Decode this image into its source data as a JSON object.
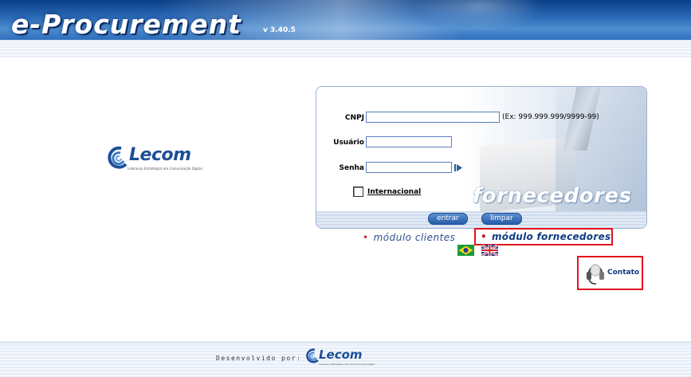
{
  "header": {
    "title": "e-Procurement",
    "version": "v 3.40.5"
  },
  "brand": {
    "logo_text": "Lecom",
    "tagline": "Liderança Estratégica em Comunicação Digital",
    "color": "#1d4f97"
  },
  "login": {
    "module_image_text": "fornecedores",
    "fields": {
      "cnpj_label": "CNPJ",
      "cnpj_value": "",
      "cnpj_hint": "(Ex: 999.999.999/9999-99)",
      "usuario_label": "Usuário",
      "usuario_value": "",
      "senha_label": "Senha",
      "senha_value": ""
    },
    "internacional": {
      "label": "Internacional",
      "checked": false
    },
    "buttons": {
      "enter": "entrar",
      "clear": "limpar"
    }
  },
  "modules": {
    "clientes": "módulo clientes",
    "fornecedores": "módulo fornecedores",
    "highlight_color": "#e0141d"
  },
  "languages": [
    {
      "name": "brazil-flag-icon"
    },
    {
      "name": "uk-flag-icon"
    }
  ],
  "contact": {
    "label": "Contato",
    "icon": "headset-icon"
  },
  "footer": {
    "developed_by": "Desenvolvido por:",
    "logo_text": "Lecom"
  }
}
